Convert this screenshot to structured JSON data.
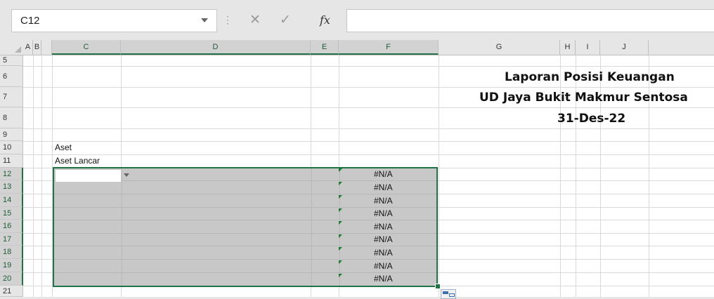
{
  "formula_bar": {
    "name_box": "C12",
    "cancel_icon": "✕",
    "enter_icon": "✓",
    "function_icon": "fx",
    "separator": "⋮",
    "formula": ""
  },
  "columns": [
    "A",
    "B",
    "C",
    "D",
    "E",
    "F",
    "G",
    "H",
    "I",
    "J"
  ],
  "rows": [
    "5",
    "6",
    "7",
    "8",
    "9",
    "10",
    "11",
    "12",
    "13",
    "14",
    "15",
    "16",
    "17",
    "18",
    "19",
    "20",
    "21"
  ],
  "report": {
    "title": "Laporan Posisi Keuangan",
    "company": "UD Jaya Bukit Makmur Sentosa",
    "date": "31-Des-22"
  },
  "cells": {
    "c10": "Aset",
    "c11": "Aset Lancar"
  },
  "values": [
    "#N/A",
    "#N/A",
    "#N/A",
    "#N/A",
    "#N/A",
    "#N/A",
    "#N/A",
    "#N/A",
    "#N/A"
  ],
  "colors": {
    "selection_border": "#217346",
    "selection_fill": "#c8c8c8",
    "error_triangle": "#1c7a2e"
  }
}
